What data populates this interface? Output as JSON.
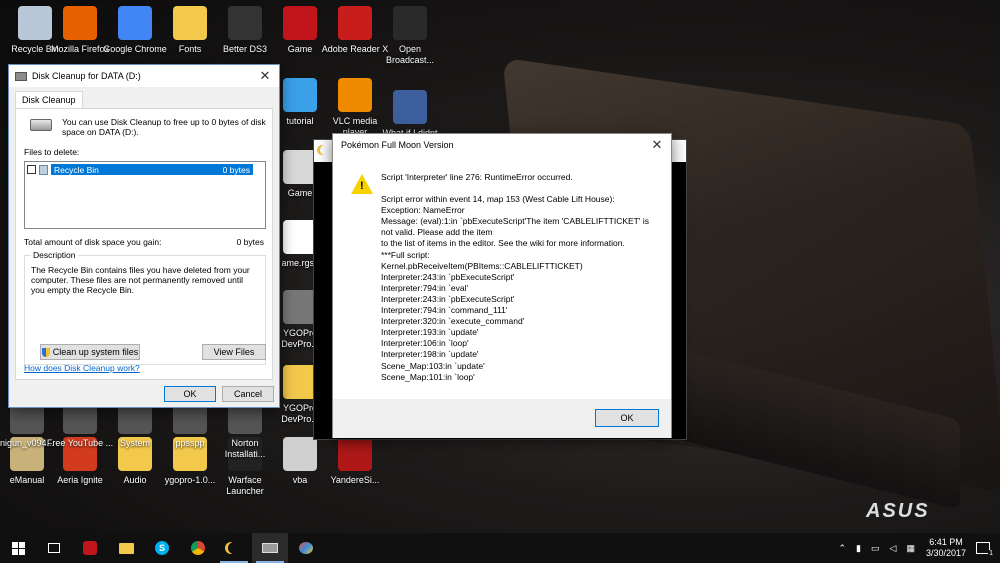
{
  "desktop": {
    "icons": [
      {
        "label": "Recycle Bin",
        "color": "#b8c8d8"
      },
      {
        "label": "Mozilla Firefox",
        "color": "#e66000"
      },
      {
        "label": "Google Chrome",
        "color": "#4285f4"
      },
      {
        "label": "Fonts",
        "color": "#f3c94b"
      },
      {
        "label": "Better DS3",
        "color": "#333333"
      },
      {
        "label": "Game",
        "color": "#c0151b"
      },
      {
        "label": "Adobe Reader X",
        "color": "#c81d1d"
      },
      {
        "label": "Open Broadcast...",
        "color": "#2a2a2a"
      },
      {
        "label": "tutorial",
        "color": "#3aa0e8"
      },
      {
        "label": "VLC media player",
        "color": "#f08a00"
      },
      {
        "label": "What if I didnt retire",
        "color": "#3d5f9e"
      },
      {
        "label": "Game",
        "color": "#d8d8d8"
      },
      {
        "label": "ame.rgss",
        "color": "#ffffff"
      },
      {
        "label": "YGOPro DevPro...",
        "color": "#777777"
      },
      {
        "label": "YGOPro DevPro...",
        "color": "#f3c94b"
      },
      {
        "label": "eManual",
        "color": "#c9b27a"
      },
      {
        "label": "Aeria Ignite",
        "color": "#d33b1f"
      },
      {
        "label": "Audio",
        "color": "#f3c94b"
      },
      {
        "label": "ygopro-1.0...",
        "color": "#f3c94b"
      },
      {
        "label": "Warface Launcher",
        "color": "#222222"
      },
      {
        "label": "vba",
        "color": "#cfcfcf"
      },
      {
        "label": "YandereSi...",
        "color": "#b01818"
      },
      {
        "label": "nigun_v094...",
        "color": "#555555"
      },
      {
        "label": "Free YouTube ...",
        "color": "#555555"
      },
      {
        "label": "System",
        "color": "#555555"
      },
      {
        "label": "ppsspp",
        "color": "#555555"
      },
      {
        "label": "Norton Installati...",
        "color": "#555555"
      }
    ],
    "brand": "ASUS"
  },
  "disk_cleanup": {
    "title": "Disk Cleanup for DATA (D:)",
    "tab": "Disk Cleanup",
    "intro": "You can use Disk Cleanup to free up to 0 bytes of disk space on DATA (D:).",
    "files_to_delete_label": "Files to delete:",
    "files": [
      {
        "name": "Recycle Bin",
        "size": "0 bytes",
        "checked": false
      }
    ],
    "total_label": "Total amount of disk space you gain:",
    "total_value": "0 bytes",
    "description_label": "Description",
    "description": "The Recycle Bin contains files you have deleted from your computer. These files are not permanently removed until you empty the Recycle Bin.",
    "clean_system_button": "Clean up system files",
    "view_files_button": "View Files",
    "help_link": "How does Disk Cleanup work?",
    "ok_button": "OK",
    "cancel_button": "Cancel"
  },
  "error_dialog": {
    "title": "Pokémon Full Moon Version",
    "message_lines": [
      "Script 'Interpreter' line 276: RuntimeError occurred.",
      "",
      "Script error within event 14, map 153 (West Cable Lift House):",
      "Exception: NameError",
      "Message: (eval):1:in `pbExecuteScript'The item 'CABLELIFTTICKET' is",
      "not valid. Please add the item",
      "to the list of items in the editor. See the wiki for more information.",
      "***Full script:",
      "Kernel.pbReceiveItem(PBItems::CABLELIFTTICKET)",
      "Interpreter:243:in `pbExecuteScript'",
      "Interpreter:794:in `eval'",
      "Interpreter:243:in `pbExecuteScript'",
      "Interpreter:794:in `command_111'",
      "Interpreter:320:in `execute_command'",
      "Interpreter:193:in `update'",
      "Interpreter:106:in `loop'",
      "Interpreter:198:in `update'",
      "Scene_Map:103:in `update'",
      "Scene_Map:101:in `loop'"
    ],
    "ok_button": "OK"
  },
  "taskbar": {
    "time": "6:41 PM",
    "date": "3/30/2017",
    "notification_count": "1"
  },
  "colors": {
    "selection": "#0078d7",
    "link": "#0066cc",
    "warning": "#f7d100"
  }
}
